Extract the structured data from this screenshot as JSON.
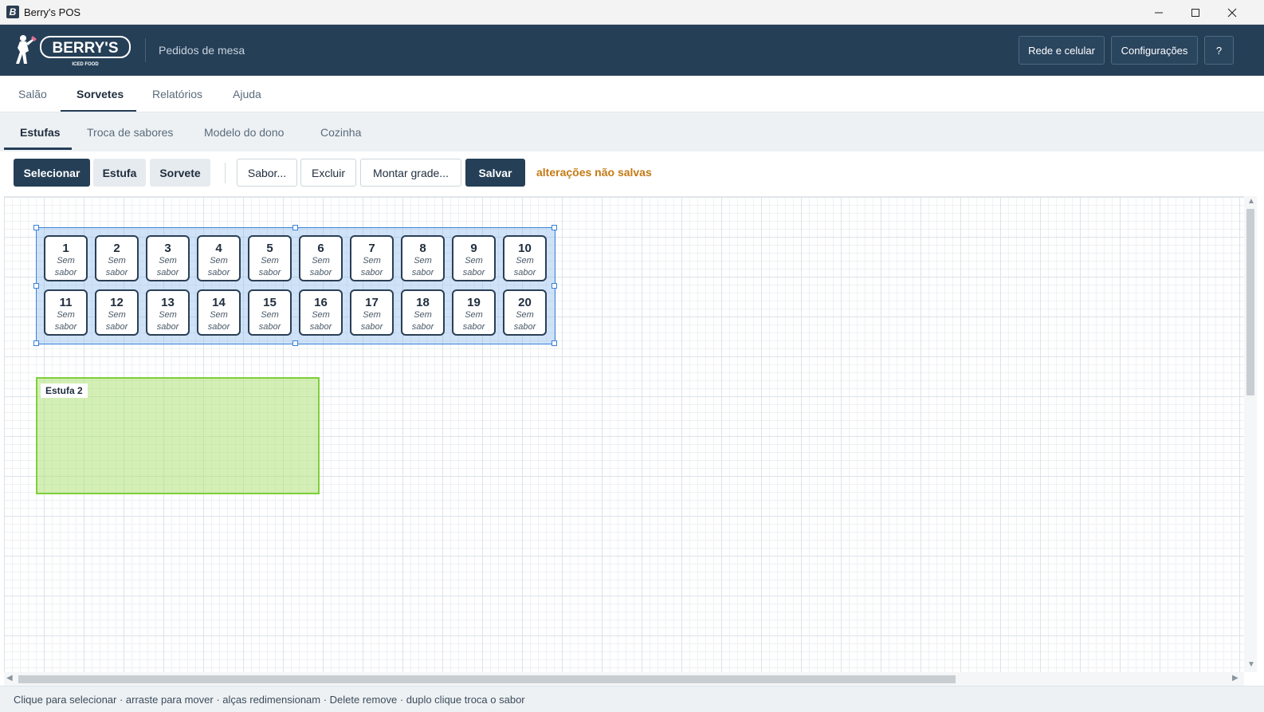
{
  "window": {
    "title": "Berry's POS"
  },
  "header": {
    "logo_text": "BERRY'S",
    "logo_subtext": "ICED FOOD",
    "subtitle": "Pedidos de mesa",
    "buttons": {
      "network": "Rede e celular",
      "settings": "Configurações",
      "help": "?"
    }
  },
  "main_tabs": [
    {
      "label": "Salão"
    },
    {
      "label": "Sorvetes",
      "active": true
    },
    {
      "label": "Relatórios"
    },
    {
      "label": "Ajuda"
    }
  ],
  "sub_tabs": [
    {
      "label": "Estufas",
      "active": true
    },
    {
      "label": "Troca de sabores"
    },
    {
      "label": "Modelo do dono"
    },
    {
      "label": "Cozinha"
    }
  ],
  "toolbar": {
    "select": "Selecionar",
    "estufa": "Estufa",
    "sorvete": "Sorvete",
    "sabor": "Sabor...",
    "excluir": "Excluir",
    "montar_grade": "Montar grade...",
    "salvar": "Salvar",
    "unsaved": "alterações não salvas"
  },
  "estufa1": {
    "slot_label": "Sem sabor",
    "slots": [
      {
        "num": "1",
        "flavor": "Sem sabor"
      },
      {
        "num": "2",
        "flavor": "Sem sabor"
      },
      {
        "num": "3",
        "flavor": "Sem sabor"
      },
      {
        "num": "4",
        "flavor": "Sem sabor"
      },
      {
        "num": "5",
        "flavor": "Sem sabor"
      },
      {
        "num": "6",
        "flavor": "Sem sabor"
      },
      {
        "num": "7",
        "flavor": "Sem sabor"
      },
      {
        "num": "8",
        "flavor": "Sem sabor"
      },
      {
        "num": "9",
        "flavor": "Sem sabor"
      },
      {
        "num": "10",
        "flavor": "Sem sabor"
      },
      {
        "num": "11",
        "flavor": "Sem sabor"
      },
      {
        "num": "12",
        "flavor": "Sem sabor"
      },
      {
        "num": "13",
        "flavor": "Sem sabor"
      },
      {
        "num": "14",
        "flavor": "Sem sabor"
      },
      {
        "num": "15",
        "flavor": "Sem sabor"
      },
      {
        "num": "16",
        "flavor": "Sem sabor"
      },
      {
        "num": "17",
        "flavor": "Sem sabor"
      },
      {
        "num": "18",
        "flavor": "Sem sabor"
      },
      {
        "num": "19",
        "flavor": "Sem sabor"
      },
      {
        "num": "20",
        "flavor": "Sem sabor"
      }
    ]
  },
  "estufa2": {
    "label": "Estufa 2"
  },
  "status": {
    "text": "Clique para selecionar · arraste para mover · alças redimensionam · Delete remove · duplo clique troca o sabor"
  },
  "colors": {
    "header_bg": "#253f57",
    "accent_unsaved": "#c47a14",
    "estufa1_border": "#3a82d8",
    "estufa2_border": "#7fcf3a"
  },
  "icons": [
    "app-icon",
    "minimize-icon",
    "maximize-icon",
    "close-icon",
    "logo-mascot-icon"
  ]
}
